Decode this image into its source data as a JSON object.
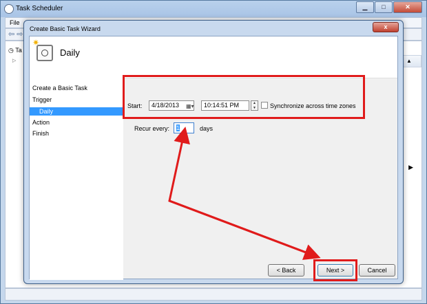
{
  "parent_window": {
    "title": "Task Scheduler",
    "menu": "File",
    "tree_label": "Ta",
    "right_header": ""
  },
  "dialog": {
    "title": "Create Basic Task Wizard",
    "page_title": "Daily",
    "close_label": "x"
  },
  "steps": [
    {
      "label": "Create a Basic Task"
    },
    {
      "label": "Trigger"
    },
    {
      "label": "Daily"
    },
    {
      "label": "Action"
    },
    {
      "label": "Finish"
    }
  ],
  "form": {
    "start_label": "Start:",
    "start_date": "4/18/2013",
    "start_time": "10:14:51 PM",
    "sync_label": "Synchronize across time zones",
    "sync_checked": false,
    "recur_label": "Recur every:",
    "recur_value": "1",
    "days_label": "days"
  },
  "buttons": {
    "back": "< Back",
    "next": "Next >",
    "cancel": "Cancel"
  },
  "colors": {
    "annotation": "#e01b1b",
    "selection": "#3399ff"
  }
}
